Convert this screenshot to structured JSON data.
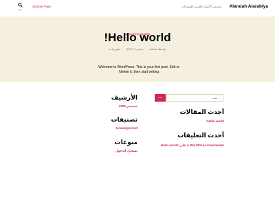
{
  "header": {
    "site_title": "Alaraiah Alarabiya",
    "site_description": "معرض الأشياء العربية للسيارات",
    "nav_link": "Sample Page",
    "search_label": "بحث"
  },
  "post": {
    "category": "UNCATEGORIZED",
    "title": "!Hello world",
    "meta_author": "بواسطة admin",
    "meta_date": "سبتمبر 7, 2020",
    "meta_comments": "تعليق واحد",
    "content": "Welcome to WordPress. This is your first post. Edit or !delete it, then start writing"
  },
  "widgets": {
    "search_placeholder": "بحث …",
    "search_button": "بحث",
    "recent_posts_title": "أحدث المقالات",
    "recent_posts": [
      "!Hello world"
    ],
    "recent_comments_title": "أحدث التعليقات",
    "recent_comment": "A WordPress Commenter على !Hello world",
    "archives_title": "الأرشيف",
    "archives": [
      "سبتمبر 2020"
    ],
    "categories_title": "تصنيفات",
    "categories": [
      "Uncategorized"
    ],
    "meta_title": "منوعات",
    "meta_items": [
      "تسجيل الدخول"
    ]
  },
  "colors": {
    "accent": "#cd2653",
    "background": "#f5efe0"
  }
}
